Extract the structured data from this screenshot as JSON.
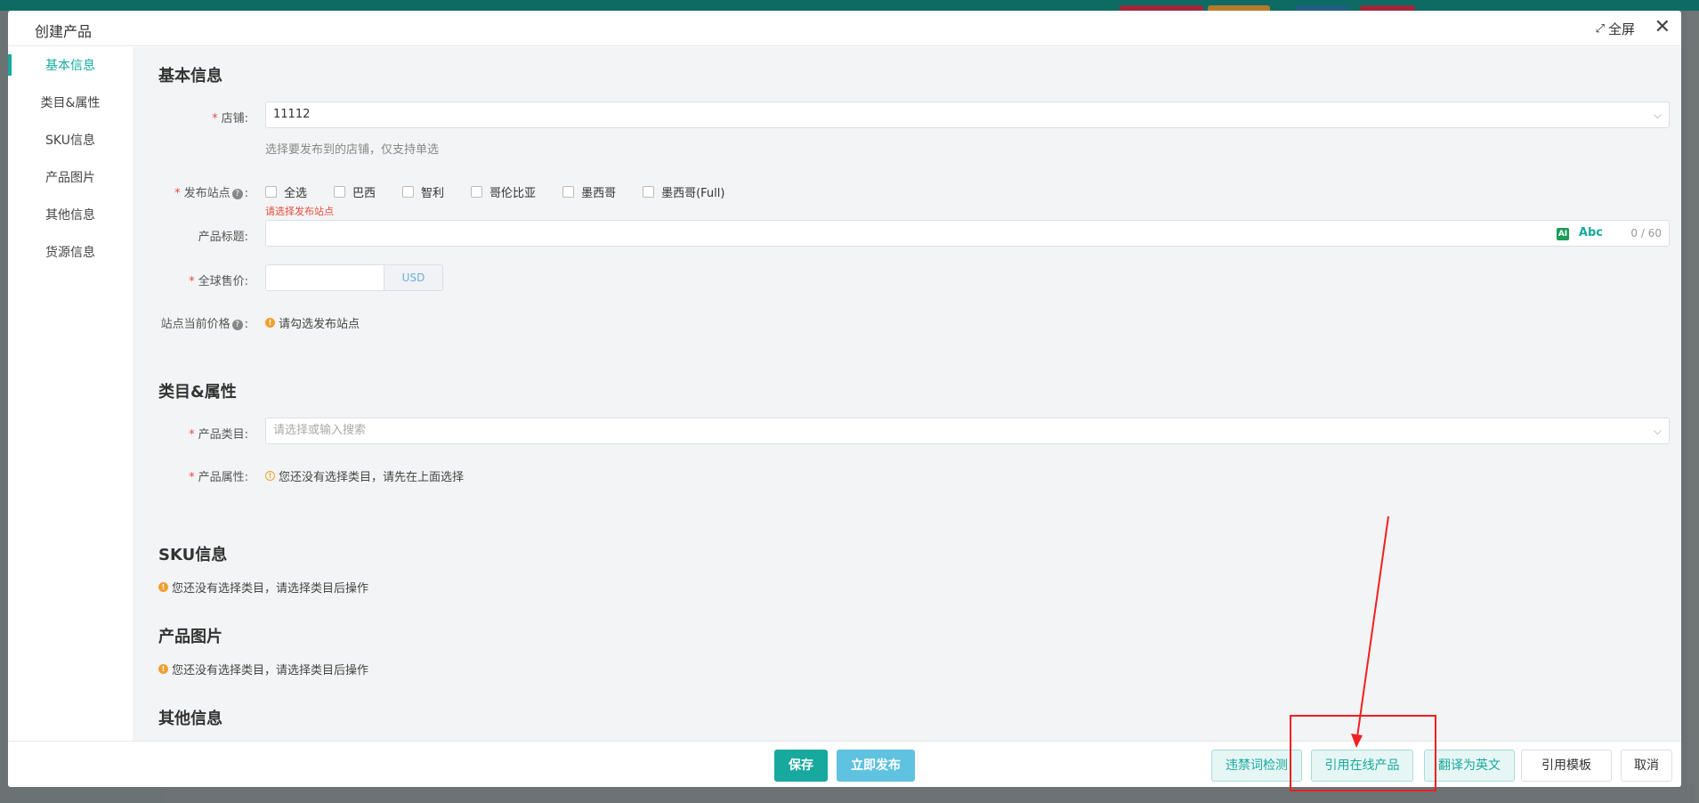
{
  "modal": {
    "title": "创建产品",
    "fullscreen_label": "全屏",
    "close_symbol": "✕"
  },
  "sidebar": {
    "items": [
      {
        "label": "基本信息",
        "active": true
      },
      {
        "label": "类目&属性"
      },
      {
        "label": "SKU信息"
      },
      {
        "label": "产品图片"
      },
      {
        "label": "其他信息"
      },
      {
        "label": "货源信息"
      }
    ]
  },
  "basic": {
    "section_title": "基本信息",
    "shop_label": "店铺:",
    "shop_value": "11112",
    "shop_hint": "选择要发布到的店铺，仅支持单选",
    "sites_label": "发布站点",
    "sites": [
      "全选",
      "巴西",
      "智利",
      "哥伦比亚",
      "墨西哥",
      "墨西哥(Full)"
    ],
    "sites_error": "请选择发布站点",
    "title_label": "产品标题:",
    "title_ai": "AI",
    "title_abc": "Abc",
    "title_counter": "0 / 60",
    "price_label": "全球售价:",
    "price_unit": "USD",
    "site_price_label": "站点当前价格",
    "site_price_hint": "请勾选发布站点"
  },
  "category": {
    "section_title": "类目&属性",
    "category_label": "产品类目:",
    "category_placeholder": "请选择或输入搜索",
    "attr_label": "产品属性:",
    "attr_hint": "您还没有选择类目，请先在上面选择"
  },
  "sku": {
    "section_title": "SKU信息",
    "hint": "您还没有选择类目，请选择类目后操作"
  },
  "images": {
    "section_title": "产品图片",
    "hint": "您还没有选择类目，请选择类目后操作"
  },
  "other": {
    "section_title": "其他信息"
  },
  "footer": {
    "save": "保存",
    "publish": "立即发布",
    "check_words": "违禁词检测",
    "reference_online": "引用在线产品",
    "translate": "翻译为英文",
    "reference_template": "引用模板",
    "cancel": "取消"
  },
  "colors": {
    "accent": "#17a89e",
    "annotation": "#f02020"
  }
}
